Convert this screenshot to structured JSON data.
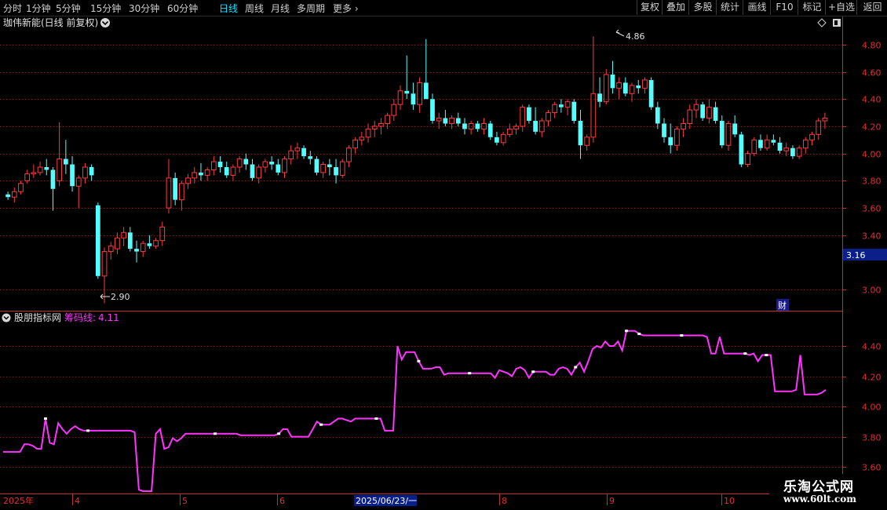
{
  "toolbar": {
    "periods": [
      "分时",
      "1分钟",
      "5分钟",
      "15分钟",
      "30分钟",
      "60分钟",
      "日线",
      "周线",
      "月线",
      "多周期",
      "更多"
    ],
    "active": "日线",
    "right_buttons": [
      "复权",
      "叠加",
      "多股",
      "统计",
      "画线",
      "F10",
      "标记",
      "+自选",
      "返回"
    ]
  },
  "colors": {
    "up": "#ff3b3b",
    "down": "#54ffff",
    "chip_line": "#ff33ff",
    "grid": "#8b1a1a",
    "axis": "#c0302f"
  },
  "main_panel": {
    "title": "珈伟新能(日线 前复权)",
    "price_ticks": [
      "4.80",
      "4.60",
      "4.40",
      "4.20",
      "4.00",
      "3.80",
      "3.60",
      "3.40",
      "3.00"
    ],
    "current_price_badge": "3.16",
    "high_label": "4.86",
    "low_label": "2.90",
    "finance_badge": "财"
  },
  "indicator_panel": {
    "name": "股朋指标网",
    "line_label": "筹码线:",
    "line_value": "4.11",
    "ticks": [
      "4.40",
      "4.20",
      "4.00",
      "3.80",
      "3.60"
    ]
  },
  "date_axis": {
    "year": "2025年",
    "months": [
      "4",
      "5",
      "6",
      "8",
      "9",
      "10"
    ],
    "cursor_date": "2025/06/23/一"
  },
  "watermark": {
    "name": "乐淘公式网",
    "url": "www.60lt.com"
  },
  "chart_data": {
    "type": "candlestick",
    "ohlc_estimated": [
      [
        3.7,
        3.72,
        3.66,
        3.68
      ],
      [
        3.68,
        3.75,
        3.64,
        3.72
      ],
      [
        3.72,
        3.8,
        3.7,
        3.78
      ],
      [
        3.8,
        3.88,
        3.78,
        3.85
      ],
      [
        3.85,
        3.92,
        3.82,
        3.86
      ],
      [
        3.86,
        3.94,
        3.84,
        3.9
      ],
      [
        3.9,
        3.96,
        3.84,
        3.88
      ],
      [
        3.88,
        3.9,
        3.58,
        3.74
      ],
      [
        3.8,
        4.23,
        3.76,
        3.96
      ],
      [
        3.96,
        4.1,
        3.85,
        3.92
      ],
      [
        3.92,
        3.98,
        3.72,
        3.76
      ],
      [
        3.76,
        3.84,
        3.6,
        3.82
      ],
      [
        3.82,
        3.93,
        3.78,
        3.9
      ],
      [
        3.9,
        3.92,
        3.8,
        3.84
      ],
      [
        3.62,
        3.64,
        3.08,
        3.1
      ],
      [
        3.1,
        3.31,
        2.9,
        3.28
      ],
      [
        3.28,
        3.35,
        3.22,
        3.32
      ],
      [
        3.3,
        3.42,
        3.26,
        3.38
      ],
      [
        3.38,
        3.46,
        3.32,
        3.42
      ],
      [
        3.42,
        3.46,
        3.28,
        3.3
      ],
      [
        3.3,
        3.36,
        3.2,
        3.28
      ],
      [
        3.28,
        3.36,
        3.24,
        3.34
      ],
      [
        3.34,
        3.4,
        3.3,
        3.32
      ],
      [
        3.32,
        3.38,
        3.3,
        3.36
      ],
      [
        3.36,
        3.5,
        3.32,
        3.46
      ],
      [
        3.6,
        3.96,
        3.56,
        3.82
      ],
      [
        3.82,
        3.86,
        3.62,
        3.66
      ],
      [
        3.66,
        3.8,
        3.58,
        3.78
      ],
      [
        3.78,
        3.85,
        3.74,
        3.82
      ],
      [
        3.82,
        3.9,
        3.78,
        3.86
      ],
      [
        3.86,
        3.93,
        3.8,
        3.84
      ],
      [
        3.84,
        3.9,
        3.8,
        3.88
      ],
      [
        3.88,
        3.98,
        3.84,
        3.94
      ],
      [
        3.94,
        3.98,
        3.86,
        3.9
      ],
      [
        3.9,
        3.94,
        3.82,
        3.84
      ],
      [
        3.84,
        3.92,
        3.8,
        3.9
      ],
      [
        3.9,
        3.98,
        3.86,
        3.96
      ],
      [
        3.96,
        4.0,
        3.88,
        3.92
      ],
      [
        3.92,
        3.96,
        3.8,
        3.82
      ],
      [
        3.82,
        3.92,
        3.78,
        3.9
      ],
      [
        3.9,
        3.96,
        3.86,
        3.94
      ],
      [
        3.94,
        3.98,
        3.88,
        3.92
      ],
      [
        3.92,
        3.96,
        3.84,
        3.86
      ],
      [
        3.86,
        3.98,
        3.82,
        3.96
      ],
      [
        3.96,
        4.06,
        3.92,
        4.02
      ],
      [
        4.02,
        4.08,
        3.96,
        4.04
      ],
      [
        4.04,
        4.06,
        3.96,
        3.98
      ],
      [
        3.98,
        4.02,
        3.92,
        3.96
      ],
      [
        3.96,
        3.98,
        3.84,
        3.86
      ],
      [
        3.86,
        3.94,
        3.82,
        3.92
      ],
      [
        3.92,
        3.96,
        3.84,
        3.9
      ],
      [
        3.9,
        3.96,
        3.78,
        3.84
      ],
      [
        3.84,
        3.96,
        3.82,
        3.94
      ],
      [
        3.94,
        4.06,
        3.9,
        4.04
      ],
      [
        4.04,
        4.12,
        4.0,
        4.1
      ],
      [
        4.1,
        4.16,
        4.06,
        4.12
      ],
      [
        4.12,
        4.22,
        4.08,
        4.18
      ],
      [
        4.18,
        4.24,
        4.12,
        4.2
      ],
      [
        4.2,
        4.26,
        4.14,
        4.22
      ],
      [
        4.22,
        4.3,
        4.18,
        4.28
      ],
      [
        4.28,
        4.4,
        4.24,
        4.36
      ],
      [
        4.36,
        4.5,
        4.32,
        4.46
      ],
      [
        4.46,
        4.72,
        4.4,
        4.44
      ],
      [
        4.44,
        4.52,
        4.32,
        4.36
      ],
      [
        4.36,
        4.56,
        4.3,
        4.52
      ],
      [
        4.52,
        4.84,
        4.46,
        4.4
      ],
      [
        4.4,
        4.44,
        4.22,
        4.24
      ],
      [
        4.24,
        4.3,
        4.18,
        4.26
      ],
      [
        4.26,
        4.32,
        4.2,
        4.22
      ],
      [
        4.22,
        4.28,
        4.18,
        4.26
      ],
      [
        4.26,
        4.3,
        4.2,
        4.22
      ],
      [
        4.22,
        4.26,
        4.14,
        4.18
      ],
      [
        4.18,
        4.24,
        4.14,
        4.22
      ],
      [
        4.22,
        4.24,
        4.16,
        4.18
      ],
      [
        4.18,
        4.26,
        4.14,
        4.22
      ],
      [
        4.22,
        4.24,
        4.1,
        4.12
      ],
      [
        4.12,
        4.16,
        4.06,
        4.08
      ],
      [
        4.08,
        4.16,
        4.06,
        4.14
      ],
      [
        4.14,
        4.22,
        4.12,
        4.18
      ],
      [
        4.18,
        4.22,
        4.14,
        4.2
      ],
      [
        4.2,
        4.36,
        4.16,
        4.34
      ],
      [
        4.34,
        4.36,
        4.22,
        4.24
      ],
      [
        4.24,
        4.34,
        4.14,
        4.16
      ],
      [
        4.16,
        4.26,
        4.12,
        4.24
      ],
      [
        4.24,
        4.32,
        4.2,
        4.3
      ],
      [
        4.3,
        4.38,
        4.26,
        4.36
      ],
      [
        4.36,
        4.4,
        4.3,
        4.34
      ],
      [
        4.34,
        4.4,
        4.28,
        4.38
      ],
      [
        4.38,
        4.4,
        4.22,
        4.24
      ],
      [
        4.24,
        4.32,
        3.96,
        4.06
      ],
      [
        4.06,
        4.14,
        4.02,
        4.12
      ],
      [
        4.12,
        4.86,
        4.08,
        4.44
      ],
      [
        4.44,
        4.56,
        4.34,
        4.38
      ],
      [
        4.38,
        4.62,
        4.36,
        4.58
      ],
      [
        4.58,
        4.68,
        4.44,
        4.48
      ],
      [
        4.48,
        4.56,
        4.4,
        4.52
      ],
      [
        4.52,
        4.56,
        4.42,
        4.44
      ],
      [
        4.44,
        4.52,
        4.38,
        4.5
      ],
      [
        4.5,
        4.54,
        4.44,
        4.48
      ],
      [
        4.48,
        4.56,
        4.44,
        4.54
      ],
      [
        4.54,
        4.56,
        4.32,
        4.34
      ],
      [
        4.34,
        4.38,
        4.18,
        4.22
      ],
      [
        4.22,
        4.26,
        4.08,
        4.12
      ],
      [
        4.12,
        4.22,
        4.0,
        4.06
      ],
      [
        4.06,
        4.2,
        4.02,
        4.18
      ],
      [
        4.18,
        4.26,
        4.12,
        4.22
      ],
      [
        4.22,
        4.36,
        4.18,
        4.32
      ],
      [
        4.32,
        4.4,
        4.26,
        4.36
      ],
      [
        4.36,
        4.38,
        4.24,
        4.26
      ],
      [
        4.26,
        4.4,
        4.22,
        4.34
      ],
      [
        4.34,
        4.38,
        4.22,
        4.24
      ],
      [
        4.24,
        4.28,
        4.04,
        4.06
      ],
      [
        4.06,
        4.24,
        4.02,
        4.22
      ],
      [
        4.22,
        4.28,
        4.12,
        4.14
      ],
      [
        4.14,
        4.16,
        3.9,
        3.92
      ],
      [
        3.92,
        4.02,
        3.9,
        4.0
      ],
      [
        4.0,
        4.12,
        3.98,
        4.1
      ],
      [
        4.1,
        4.14,
        4.02,
        4.04
      ],
      [
        4.04,
        4.14,
        4.02,
        4.1
      ],
      [
        4.1,
        4.14,
        4.06,
        4.08
      ],
      [
        4.08,
        4.12,
        4.0,
        4.02
      ],
      [
        4.02,
        4.08,
        3.98,
        4.04
      ],
      [
        4.04,
        4.06,
        3.96,
        3.98
      ],
      [
        3.98,
        4.06,
        3.96,
        4.04
      ],
      [
        4.04,
        4.12,
        4.0,
        4.1
      ],
      [
        4.1,
        4.16,
        4.06,
        4.14
      ],
      [
        4.14,
        4.26,
        4.1,
        4.24
      ],
      [
        4.24,
        4.3,
        4.18,
        4.26
      ]
    ],
    "price_ylim": [
      2.88,
      4.92
    ],
    "indicator": {
      "name": "筹码线",
      "values": [
        3.7,
        3.7,
        3.7,
        3.7,
        3.7,
        3.75,
        3.75,
        3.74,
        3.72,
        3.72,
        3.92,
        3.76,
        3.75,
        3.89,
        3.85,
        3.82,
        3.85,
        3.87,
        3.85,
        3.84,
        3.84,
        3.84,
        3.84,
        3.84,
        3.84,
        3.84,
        3.84,
        3.84,
        3.84,
        3.84,
        3.84,
        3.83,
        3.45,
        3.44,
        3.44,
        3.44,
        3.82,
        3.85,
        3.72,
        3.73,
        3.79,
        3.77,
        3.79,
        3.82,
        3.82,
        3.82,
        3.82,
        3.82,
        3.82,
        3.82,
        3.82,
        3.82,
        3.82,
        3.82,
        3.82,
        3.82,
        3.81,
        3.81,
        3.81,
        3.81,
        3.81,
        3.81,
        3.81,
        3.81,
        3.81,
        3.82,
        3.85,
        3.85,
        3.8,
        3.8,
        3.8,
        3.8,
        3.8,
        3.85,
        3.9,
        3.88,
        3.88,
        3.88,
        3.9,
        3.92,
        3.92,
        3.91,
        3.9,
        3.92,
        3.92,
        3.92,
        3.92,
        3.92,
        3.92,
        3.92,
        3.84,
        3.84,
        3.84,
        4.4,
        4.31,
        4.36,
        4.36,
        4.36,
        4.3,
        4.25,
        4.25,
        4.25,
        4.26,
        4.26,
        4.21,
        4.22,
        4.22,
        4.22,
        4.22,
        4.22,
        4.22,
        4.22,
        4.22,
        4.22,
        4.22,
        4.22,
        4.19,
        4.24,
        4.23,
        4.22,
        4.2,
        4.25,
        4.26,
        4.24,
        4.19,
        4.23,
        4.23,
        4.23,
        4.23,
        4.21,
        4.21,
        4.25,
        4.26,
        4.25,
        4.21,
        4.26,
        4.29,
        4.23,
        4.3,
        4.38,
        4.4,
        4.39,
        4.43,
        4.4,
        4.4,
        4.43,
        4.37,
        4.5,
        4.5,
        4.5,
        4.48,
        4.47,
        4.47,
        4.47,
        4.47,
        4.47,
        4.47,
        4.47,
        4.47,
        4.47,
        4.47,
        4.47,
        4.47,
        4.47,
        4.47,
        4.47,
        4.46,
        4.35,
        4.35,
        4.46,
        4.35,
        4.35,
        4.35,
        4.35,
        4.35,
        4.35,
        4.34,
        4.35,
        4.3,
        4.34,
        4.34,
        4.34,
        4.1,
        4.1,
        4.1,
        4.1,
        4.1,
        4.11,
        4.34,
        4.08,
        4.08,
        4.08,
        4.08,
        4.09,
        4.11
      ],
      "ylim": [
        3.44,
        4.54
      ]
    }
  }
}
